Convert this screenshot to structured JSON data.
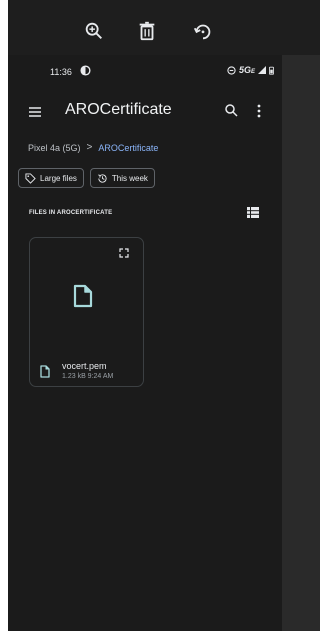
{
  "toolbar": {
    "zoom_icon": "zoom-in-icon",
    "delete_icon": "trash-icon",
    "rotate_icon": "rotate-icon"
  },
  "status_bar": {
    "time": "11:36",
    "network": "5G",
    "network_sub": "E"
  },
  "app_bar": {
    "title": "AROCertificate"
  },
  "breadcrumb": {
    "root": "Pixel 4a (5G)",
    "separator": ">",
    "current": "AROCertificate"
  },
  "filters": [
    {
      "label": "Large files",
      "icon": "tag-icon"
    },
    {
      "label": "This week",
      "icon": "history-icon"
    }
  ],
  "section": {
    "label": "FILES IN AROCERTIFICATE"
  },
  "files": [
    {
      "name": "vocert.pem",
      "meta": "1.23 kB 9:24 AM"
    }
  ],
  "colors": {
    "accent": "#8ab4f8",
    "background": "#1b1b1b",
    "text": "#e8eaed"
  }
}
